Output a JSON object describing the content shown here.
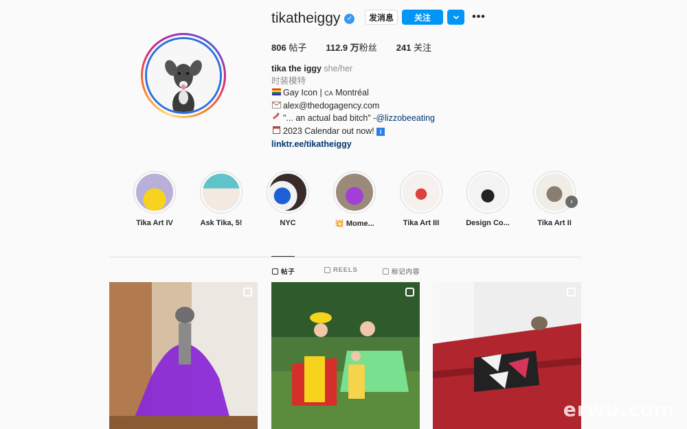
{
  "profile": {
    "username": "tikatheiggy",
    "verified": true,
    "message_label": "发消息",
    "follow_label": "关注",
    "dropdown_icon": "chevron-down-icon",
    "more_icon": "more-horizontal-icon"
  },
  "stats": {
    "posts_count": "806",
    "posts_label": "帖子",
    "followers_count": "112.9 万",
    "followers_label": "粉丝",
    "following_count": "241",
    "following_label": "关注"
  },
  "bio": {
    "name": "tika the iggy",
    "pronouns": "she/her",
    "category": "时装模特",
    "line1": "Gay Icon | ",
    "line1_flag": "CA",
    "line1_city": "Montréal",
    "line2": "alex@thedogagency.com",
    "line3_text": "\"... an actual bad bitch\" -",
    "line3_mention": "@lizzobeeating",
    "line4": "2023 Calendar out now!",
    "link": "linktr.ee/tikatheiggy"
  },
  "highlights": [
    {
      "label": "Tika Art IV"
    },
    {
      "label": "Ask Tika, 5!"
    },
    {
      "label": "NYC"
    },
    {
      "label": "💥 Mome..."
    },
    {
      "label": "Tika Art III"
    },
    {
      "label": "Design Co..."
    },
    {
      "label": "Tika Art II"
    }
  ],
  "tabs": [
    {
      "label": "帖子",
      "active": true
    },
    {
      "label": "REELS",
      "active": false
    },
    {
      "label": "标记内容",
      "active": false
    }
  ],
  "watermark": "erwu.com",
  "colors": {
    "accent": "#0095f6",
    "verified": "#3897f0",
    "link": "#00376b",
    "text": "#262626",
    "muted": "#8e8e8e",
    "background": "#fafafa"
  }
}
